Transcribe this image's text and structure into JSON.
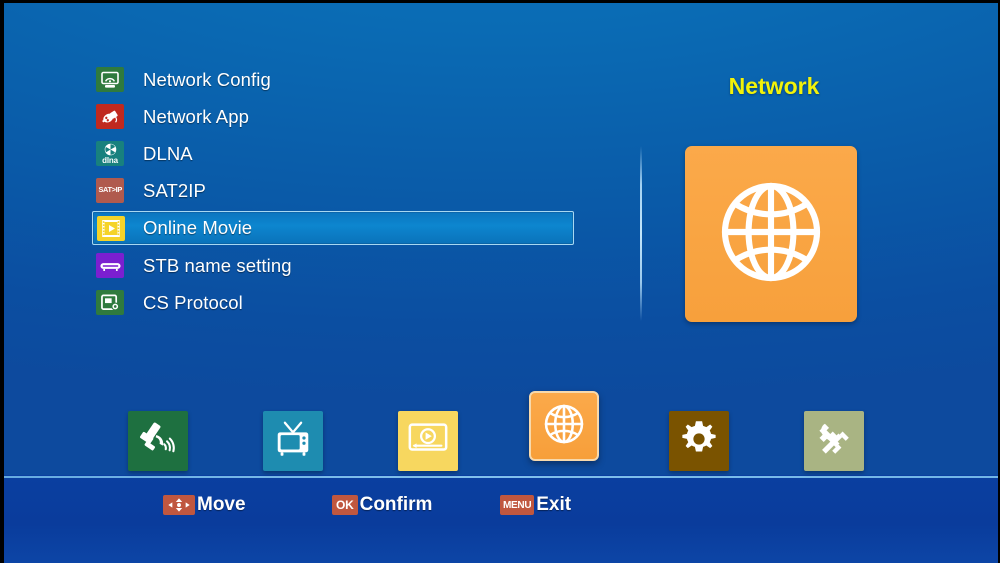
{
  "screen": {
    "background_color": "#0a5ca9",
    "accent_orange": "#f9a543",
    "title_color": "#f2f20a",
    "key_color": "#c0573f"
  },
  "menu": {
    "selected_index": 4,
    "items": [
      {
        "label": "Network Config",
        "icon": "network-config-icon",
        "icon_color": "#2f7a3e"
      },
      {
        "label": "Network App",
        "icon": "network-app-icon",
        "icon_color": "#c0291f"
      },
      {
        "label": "DLNA",
        "icon": "dlna-icon",
        "icon_color": "#18817e",
        "icon_text": "dlna"
      },
      {
        "label": "SAT2IP",
        "icon": "sat-ip-icon",
        "icon_color": "#b05a4e",
        "icon_text": "SAT>IP"
      },
      {
        "label": "Online Movie",
        "icon": "online-movie-icon",
        "icon_color": "#f5d328"
      },
      {
        "label": "STB name setting",
        "icon": "stb-name-icon",
        "icon_color": "#7b1fd0"
      },
      {
        "label": "CS Protocol",
        "icon": "cs-protocol-icon",
        "icon_color": "#2f7a3e"
      }
    ]
  },
  "preview": {
    "title": "Network",
    "icon": "globe-icon",
    "tile_color": "#f9a543"
  },
  "category_bar": {
    "active_index": 3,
    "items": [
      {
        "name": "satellite-icon",
        "color": "#1e7040"
      },
      {
        "name": "tv-icon",
        "color": "#1e8cb0"
      },
      {
        "name": "media-player-icon",
        "color": "#f7d75f"
      },
      {
        "name": "globe-icon",
        "color": "#f9a543"
      },
      {
        "name": "gear-icon",
        "color": "#7a5300"
      },
      {
        "name": "tools-icon",
        "color": "#a9b483"
      }
    ]
  },
  "hints": [
    {
      "key": "",
      "label": "Move",
      "key_icon": "dpad-icon"
    },
    {
      "key": "OK",
      "label": "Confirm",
      "key_icon": ""
    },
    {
      "key": "MENU",
      "label": "Exit",
      "key_icon": ""
    }
  ]
}
